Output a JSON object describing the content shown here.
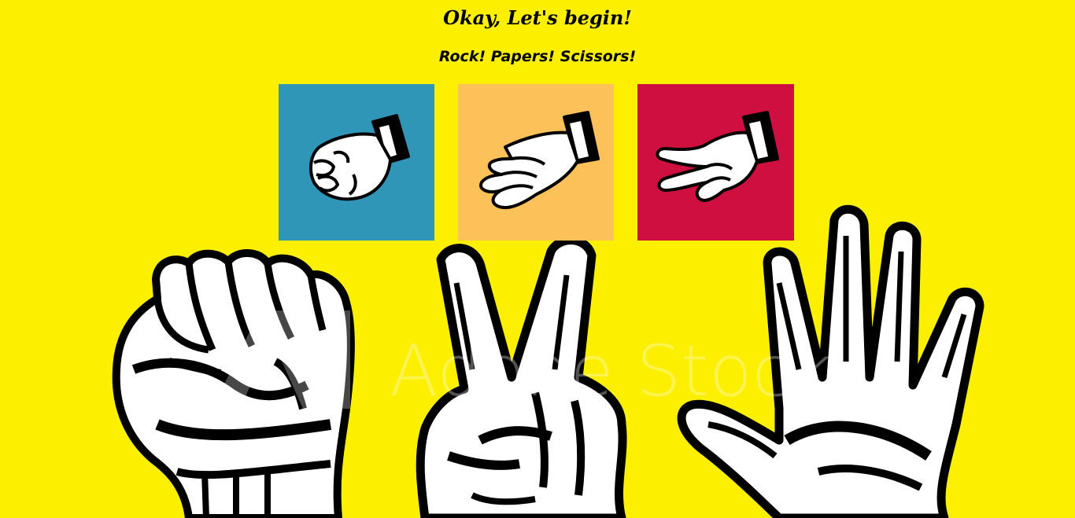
{
  "game": {
    "title": "Okay, Let's begin!",
    "subtitle": "Rock! Papers! Scissors!"
  },
  "choices": [
    {
      "id": "rock",
      "label": "Rock",
      "icon": "rock-hand-icon",
      "color": "#3096B8"
    },
    {
      "id": "paper",
      "label": "Paper",
      "icon": "paper-hand-icon",
      "color": "#FDC15A"
    },
    {
      "id": "scissors",
      "label": "Scissors",
      "icon": "scissors-hand-icon",
      "color": "#CF0F3F"
    }
  ],
  "background": {
    "color": "#FCEF00",
    "watermark_text": "Adobe Stock",
    "illustration": "fist-peace-open-hand-illustration"
  }
}
